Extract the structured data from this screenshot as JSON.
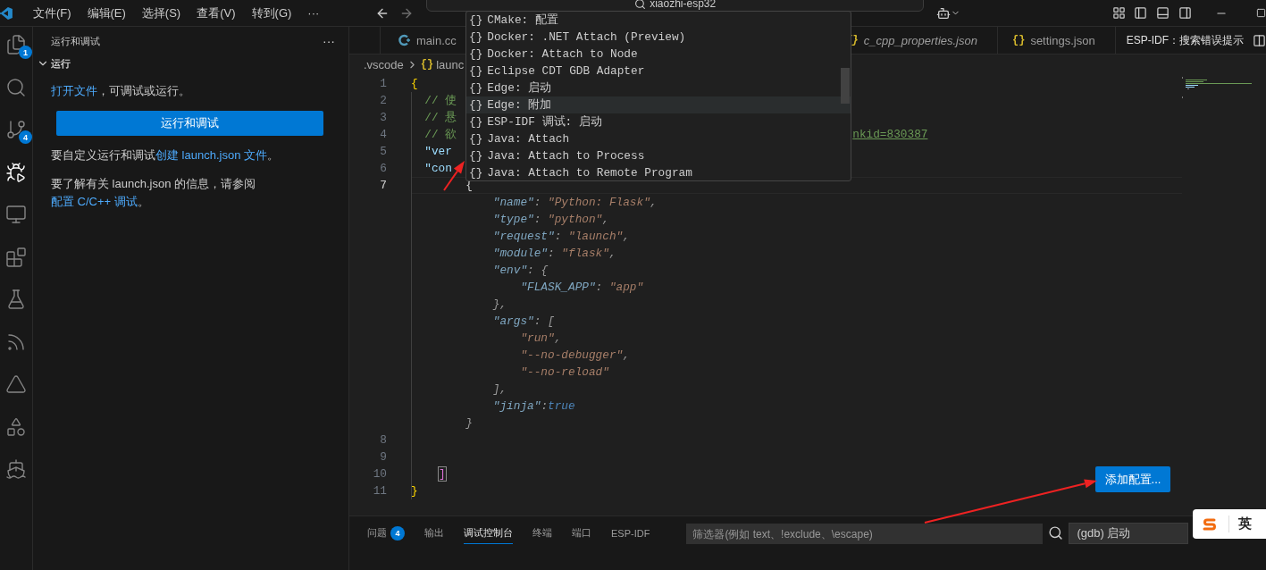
{
  "title_bar": {
    "menus": [
      "文件(F)",
      "编辑(E)",
      "选择(S)",
      "查看(V)",
      "转到(G)",
      "···"
    ],
    "search": "xiaozhi-esp32"
  },
  "activity_bar": [
    {
      "kind": "explorer",
      "badge": "1",
      "selected": false
    },
    {
      "kind": "search",
      "selected": false
    },
    {
      "kind": "source-control",
      "badge": "4",
      "selected": false
    },
    {
      "kind": "run-debug",
      "selected": true
    },
    {
      "kind": "remote",
      "selected": false
    },
    {
      "kind": "extensions",
      "selected": false
    },
    {
      "kind": "testing",
      "selected": false
    },
    {
      "kind": "espressif",
      "selected": false
    },
    {
      "kind": "tool",
      "selected": false
    },
    {
      "kind": "shapes",
      "selected": false
    },
    {
      "kind": "docker",
      "selected": false
    }
  ],
  "sidebar": {
    "title": "运行和调试",
    "more": "···",
    "section": {
      "title": "运行",
      "expanded": true
    },
    "content": [
      {
        "kind": "text",
        "parts": [
          {
            "text": "打开文件",
            "link": true
          },
          {
            "text": "，可调试或运行。",
            "link": false
          }
        ]
      },
      {
        "kind": "button",
        "label": "运行和调试"
      },
      {
        "kind": "text",
        "parts": [
          {
            "text": "要自定义运行和调试",
            "link": false
          },
          {
            "text": "创建 launch.json 文件",
            "link": true
          },
          {
            "text": "。",
            "link": false
          }
        ]
      },
      {
        "kind": "text",
        "parts": [
          {
            "text": "要了解有关 launch.json 的信息，请参阅 ",
            "link": false
          },
          {
            "text": "配置 C/C++ 调试",
            "link": true
          },
          {
            "text": "。",
            "link": false
          }
        ]
      }
    ]
  },
  "editor": {
    "tabs": [
      {
        "kind": "cpp",
        "label": "main.cc",
        "preview": false
      },
      {
        "kind": "json",
        "glyph": "{}",
        "label": "c_cpp_properties.json",
        "preview": true
      },
      {
        "kind": "json",
        "glyph": "{}",
        "label": "settings.json",
        "preview": false
      },
      {
        "kind": "webview",
        "label": "ESP-IDF：搜索错误提示",
        "preview": false
      }
    ],
    "breadcrumb": {
      "folder": ".vscode",
      "glyph": "{}",
      "file": "launc"
    },
    "lines": [
      {
        "kind": "code",
        "number": "1",
        "current": false,
        "tokens": [
          {
            "kind": "brace",
            "text": "{"
          }
        ]
      },
      {
        "kind": "code",
        "number": "2",
        "current": false,
        "tokens": [
          {
            "kind": "comment",
            "text": "  // 使"
          }
        ]
      },
      {
        "kind": "code",
        "number": "3",
        "current": false,
        "tokens": [
          {
            "kind": "comment",
            "text": "  // 悬"
          }
        ]
      },
      {
        "kind": "code",
        "number": "4",
        "current": false,
        "tokens": [
          {
            "kind": "comment",
            "text": "  // 欲"
          },
          {
            "kind": "link",
            "text": "nkid=830387"
          }
        ]
      },
      {
        "kind": "code",
        "number": "5",
        "current": false,
        "tokens": [
          {
            "kind": "key",
            "text": "  \"ver"
          }
        ]
      },
      {
        "kind": "code",
        "number": "6",
        "current": false,
        "tokens": [
          {
            "kind": "key",
            "text": "  \"con"
          }
        ]
      },
      {
        "kind": "code",
        "number": "7",
        "current": true,
        "tokens": [
          {
            "kind": "punct",
            "text": "        {"
          }
        ]
      },
      {
        "kind": "ghost",
        "tokens": [
          {
            "kind": "key",
            "text": "            \"name\""
          },
          {
            "kind": "punct",
            "text": ": "
          },
          {
            "kind": "string",
            "text": "\"Python: Flask\""
          },
          {
            "kind": "punct",
            "text": ","
          }
        ]
      },
      {
        "kind": "ghost",
        "tokens": [
          {
            "kind": "key",
            "text": "            \"type\""
          },
          {
            "kind": "punct",
            "text": ": "
          },
          {
            "kind": "string",
            "text": "\"python\""
          },
          {
            "kind": "punct",
            "text": ","
          }
        ]
      },
      {
        "kind": "ghost",
        "tokens": [
          {
            "kind": "key",
            "text": "            \"request\""
          },
          {
            "kind": "punct",
            "text": ": "
          },
          {
            "kind": "string",
            "text": "\"launch\""
          },
          {
            "kind": "punct",
            "text": ","
          }
        ]
      },
      {
        "kind": "ghost",
        "tokens": [
          {
            "kind": "key",
            "text": "            \"module\""
          },
          {
            "kind": "punct",
            "text": ": "
          },
          {
            "kind": "string",
            "text": "\"flask\""
          },
          {
            "kind": "punct",
            "text": ","
          }
        ]
      },
      {
        "kind": "ghost",
        "tokens": [
          {
            "kind": "key",
            "text": "            \"env\""
          },
          {
            "kind": "punct",
            "text": ": {"
          }
        ]
      },
      {
        "kind": "ghost",
        "tokens": [
          {
            "kind": "key",
            "text": "                \"FLASK_APP\""
          },
          {
            "kind": "punct",
            "text": ": "
          },
          {
            "kind": "string",
            "text": "\"app\""
          }
        ]
      },
      {
        "kind": "ghost",
        "tokens": [
          {
            "kind": "punct",
            "text": "            },"
          }
        ]
      },
      {
        "kind": "ghost",
        "tokens": [
          {
            "kind": "key",
            "text": "            \"args\""
          },
          {
            "kind": "punct",
            "text": ": ["
          }
        ]
      },
      {
        "kind": "ghost",
        "tokens": [
          {
            "kind": "string",
            "text": "                \"run\""
          },
          {
            "kind": "punct",
            "text": ","
          }
        ]
      },
      {
        "kind": "ghost",
        "tokens": [
          {
            "kind": "string",
            "text": "                \"--no-debugger\""
          },
          {
            "kind": "punct",
            "text": ","
          }
        ]
      },
      {
        "kind": "ghost",
        "tokens": [
          {
            "kind": "string",
            "text": "                \"--no-reload\""
          }
        ]
      },
      {
        "kind": "ghost",
        "tokens": [
          {
            "kind": "punct",
            "text": "            ],"
          }
        ]
      },
      {
        "kind": "ghost",
        "tokens": [
          {
            "kind": "key",
            "text": "            \"jinja\""
          },
          {
            "kind": "punct",
            "text": ":"
          },
          {
            "kind": "bool",
            "text": "true"
          }
        ]
      },
      {
        "kind": "ghost",
        "tokens": [
          {
            "kind": "punct",
            "text": "        }"
          }
        ]
      },
      {
        "kind": "code",
        "number": "8",
        "current": false
      },
      {
        "kind": "code",
        "number": "9",
        "current": false
      },
      {
        "kind": "code",
        "number": "10",
        "current": false,
        "tokens": [
          {
            "kind": "matched",
            "text": "]"
          }
        ]
      },
      {
        "kind": "code",
        "number": "11",
        "current": false,
        "tokens": [
          {
            "kind": "brace",
            "text": "}"
          }
        ]
      }
    ],
    "add_config_button": "添加配置..."
  },
  "suggest_popup": {
    "items": [
      {
        "glyph": "{}",
        "label": "CMake: 配置",
        "selected": false
      },
      {
        "glyph": "{}",
        "label": "Docker: .NET Attach (Preview)",
        "selected": false
      },
      {
        "glyph": "{}",
        "label": "Docker: Attach to Node",
        "selected": false
      },
      {
        "glyph": "{}",
        "label": "Eclipse CDT GDB Adapter",
        "selected": false
      },
      {
        "glyph": "{}",
        "label": "Edge: 启动",
        "selected": false
      },
      {
        "glyph": "{}",
        "label": "Edge: 附加",
        "selected": true
      },
      {
        "glyph": "{}",
        "label": "ESP-IDF 调试: 启动",
        "selected": false
      },
      {
        "glyph": "{}",
        "label": "Java: Attach",
        "selected": false
      },
      {
        "glyph": "{}",
        "label": "Java: Attach to Process",
        "selected": false
      },
      {
        "glyph": "{}",
        "label": "Java: Attach to Remote Program",
        "selected": false
      }
    ]
  },
  "panel": {
    "tabs": [
      {
        "label": "问题",
        "badge": "4",
        "selected": false
      },
      {
        "label": "输出",
        "selected": false
      },
      {
        "label": "调试控制台",
        "selected": true
      },
      {
        "label": "终端",
        "selected": false
      },
      {
        "label": "端口",
        "selected": false
      },
      {
        "label": "ESP-IDF",
        "selected": false
      }
    ],
    "filter": {
      "placeholder": "筛选器(例如 text、!exclude、\\escape)"
    },
    "launch_select": "(gdb) 启动"
  },
  "ime": {
    "label": "英"
  }
}
